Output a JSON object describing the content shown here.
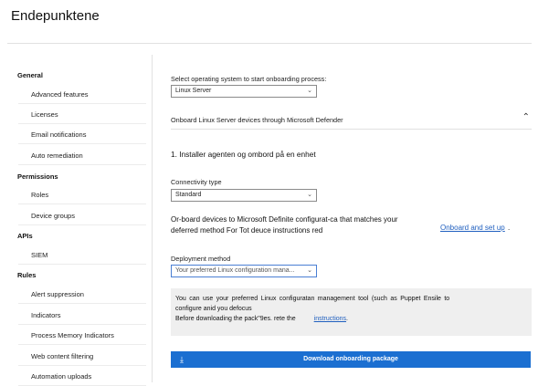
{
  "header": {
    "title": "Endepunktene"
  },
  "sidebar": {
    "groups": [
      {
        "label": "General",
        "items": [
          "Advanced features",
          "Licenses",
          "Email notifications",
          "Auto remediation"
        ]
      },
      {
        "label": "Permissions",
        "items": [
          "Roles",
          "Device groups"
        ]
      },
      {
        "label": "APIs",
        "items": [
          "SIEM"
        ]
      },
      {
        "label": "Rules",
        "items": [
          "Alert suppression",
          "Indicators",
          "Process Memory Indicators",
          "Web content filtering",
          "Automation uploads"
        ]
      }
    ]
  },
  "main": {
    "os_select_label": "Select operating system to start onboarding process:",
    "os_select_value": "Linux Server",
    "section_title": "Onboard Linux Server devices through Microsoft Defender",
    "step_title": "1. Installer agenten og ombord på en enhet",
    "connectivity_label": "Connectivity type",
    "connectivity_value": "Standard",
    "description": "Or-board devices to Microsoft Definite configurat-ca that matches your deferred method For Tot deuce instructions red",
    "onboard_link": "Onboard and set up",
    "onboard_link_suffix": ".",
    "deployment_label": "Deployment method",
    "deployment_value": "Your preferred Linux configuration mana...",
    "info_line1": "You can use your preferred Linux configuratan management tool (such as Puppet Ensile to",
    "info_line2": "configure anid you defocus",
    "info_line3": "Before downloading the pack\"9es. rete the",
    "info_link": "instructions",
    "info_link_suffix": ".",
    "download_button": "Download onboarding package"
  },
  "colors": {
    "accent": "#1b6fd1",
    "link": "#1f5fbf",
    "infobox_bg": "#efefef"
  },
  "icons": {
    "dropdown": "chevron-down-icon",
    "collapse": "chevron-up-icon",
    "download": "download-icon"
  }
}
